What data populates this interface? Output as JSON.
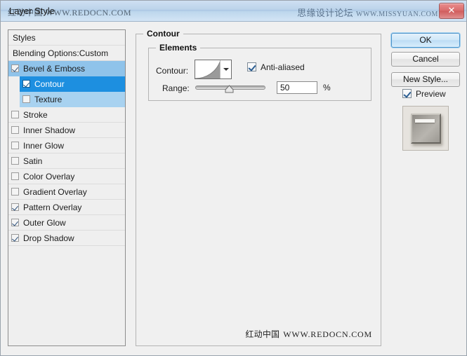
{
  "window": {
    "title": "Layer Style",
    "close_label": "✕",
    "watermark_title_left": "红动中国 WWW.REDOCN.COM",
    "watermark_title_right_cn": "思缘设计论坛",
    "watermark_title_right_en": "WWW.MISSYUAN.COM",
    "watermark_bottom_cn": "红动中国",
    "watermark_bottom_en": "WWW.REDOCN.COM"
  },
  "styles_panel": {
    "header": "Styles",
    "blending_options": "Blending Options:Custom",
    "effects": [
      {
        "label": "Bevel & Emboss",
        "checked": true,
        "state": "parent-selected",
        "indent": 0
      },
      {
        "label": "Contour",
        "checked": true,
        "state": "selected",
        "indent": 1
      },
      {
        "label": "Texture",
        "checked": false,
        "state": "sub",
        "indent": 1
      },
      {
        "label": "Stroke",
        "checked": false,
        "state": "normal",
        "indent": 0
      },
      {
        "label": "Inner Shadow",
        "checked": false,
        "state": "normal",
        "indent": 0
      },
      {
        "label": "Inner Glow",
        "checked": false,
        "state": "normal",
        "indent": 0
      },
      {
        "label": "Satin",
        "checked": false,
        "state": "normal",
        "indent": 0
      },
      {
        "label": "Color Overlay",
        "checked": false,
        "state": "normal",
        "indent": 0
      },
      {
        "label": "Gradient Overlay",
        "checked": false,
        "state": "normal",
        "indent": 0
      },
      {
        "label": "Pattern Overlay",
        "checked": true,
        "state": "normal",
        "indent": 0
      },
      {
        "label": "Outer Glow",
        "checked": true,
        "state": "normal",
        "indent": 0
      },
      {
        "label": "Drop Shadow",
        "checked": true,
        "state": "normal",
        "indent": 0
      }
    ]
  },
  "contour_panel": {
    "group_title": "Contour",
    "elements_title": "Elements",
    "contour_label": "Contour:",
    "contour_preset": "Cone - Inverted",
    "anti_aliased_label": "Anti-aliased",
    "anti_aliased_checked": true,
    "range_label": "Range:",
    "range_value": "50",
    "range_unit": "%",
    "range_percent": 50
  },
  "buttons": {
    "ok": "OK",
    "cancel": "Cancel",
    "new_style": "New Style...",
    "preview_label": "Preview",
    "preview_checked": true
  },
  "colors": {
    "titlebar_top": "#cfe0f2",
    "titlebar_bottom": "#d3e4f5",
    "selected_row": "#1d8fe0",
    "parent_row": "#8fc3ea",
    "sub_row": "#a8d2f0",
    "dialog_bg": "#f0f0f0",
    "close_button": "#d96a6a"
  }
}
